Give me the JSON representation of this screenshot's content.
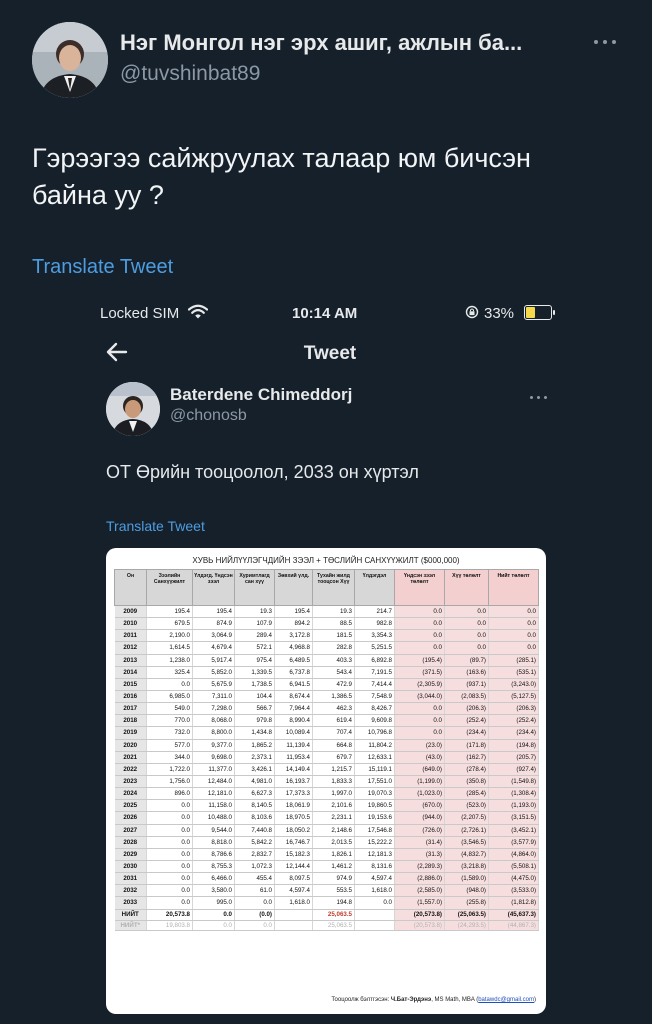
{
  "tweet": {
    "author_name": "Нэг Монгол нэг эрх ашиг, ажлын ба...",
    "author_handle": "@tuvshinbat89",
    "text_line1": "Гэрээгээ сайжруулах талаар юм бичсэн",
    "text_line2": "байна уу ?",
    "translate": "Translate Tweet"
  },
  "embedded": {
    "status_bar": {
      "carrier": "Locked SIM",
      "time": "10:14 AM",
      "battery": "33%"
    },
    "nav_title": "Tweet",
    "author_name": "Baterdene Chimeddorj",
    "author_handle": "@chonosb",
    "text": "ОТ Өрийн тооцоолол, 2033 он хүртэл",
    "translate": "Translate Tweet",
    "table": {
      "title": "ХУВЬ НИЙЛҮҮЛЭГЧДИЙН ЗЭЭЛ + ТӨСЛИЙН САНХҮҮЖИЛТ ($000,000)",
      "headers": [
        "Он",
        "Зээлийн Санхүүжилт",
        "Үлдэгд. Үндсэн зээл",
        "Хуримтлагд сан хүү",
        "Зөвхий үлд.",
        "Тухайн жилд тооцсон Хүү",
        "Үлдэгдэл",
        "Үндсэн зээл төлөлт",
        "Хүү төлөлт",
        "Нийт төлөлт"
      ],
      "rows": [
        [
          "2009",
          "195.4",
          "195.4",
          "19.3",
          "195.4",
          "19.3",
          "214.7",
          "0.0",
          "0.0",
          "0.0"
        ],
        [
          "2010",
          "679.5",
          "874.9",
          "107.9",
          "894.2",
          "88.5",
          "982.8",
          "0.0",
          "0.0",
          "0.0"
        ],
        [
          "2011",
          "2,190.0",
          "3,064.9",
          "289.4",
          "3,172.8",
          "181.5",
          "3,354.3",
          "0.0",
          "0.0",
          "0.0"
        ],
        [
          "2012",
          "1,614.5",
          "4,679.4",
          "572.1",
          "4,968.8",
          "282.8",
          "5,251.5",
          "0.0",
          "0.0",
          "0.0"
        ],
        [
          "2013",
          "1,238.0",
          "5,917.4",
          "975.4",
          "6,489.5",
          "403.3",
          "6,892.8",
          "(195.4)",
          "(89.7)",
          "(285.1)"
        ],
        [
          "2014",
          "325.4",
          "5,852.0",
          "1,339.5",
          "6,737.8",
          "543.4",
          "7,191.5",
          "(371.5)",
          "(163.6)",
          "(535.1)"
        ],
        [
          "2015",
          "0.0",
          "5,675.9",
          "1,738.5",
          "6,941.5",
          "472.9",
          "7,414.4",
          "(2,305.9)",
          "(937.1)",
          "(3,243.0)"
        ],
        [
          "2016",
          "6,985.0",
          "7,311.0",
          "104.4",
          "8,674.4",
          "1,386.5",
          "7,548.9",
          "(3,044.0)",
          "(2,083.5)",
          "(5,127.5)"
        ],
        [
          "2017",
          "549.0",
          "7,298.0",
          "566.7",
          "7,964.4",
          "462.3",
          "8,426.7",
          "0.0",
          "(206.3)",
          "(206.3)"
        ],
        [
          "2018",
          "770.0",
          "8,068.0",
          "979.8",
          "8,990.4",
          "619.4",
          "9,609.8",
          "0.0",
          "(252.4)",
          "(252.4)"
        ],
        [
          "2019",
          "732.0",
          "8,800.0",
          "1,434.8",
          "10,089.4",
          "707.4",
          "10,796.8",
          "0.0",
          "(234.4)",
          "(234.4)"
        ],
        [
          "2020",
          "577.0",
          "9,377.0",
          "1,865.2",
          "11,139.4",
          "664.8",
          "11,804.2",
          "(23.0)",
          "(171.8)",
          "(194.8)"
        ],
        [
          "2021",
          "344.0",
          "9,698.0",
          "2,373.1",
          "11,953.4",
          "679.7",
          "12,633.1",
          "(43.0)",
          "(162.7)",
          "(205.7)"
        ],
        [
          "2022",
          "1,722.0",
          "11,377.0",
          "3,426.1",
          "14,149.4",
          "1,215.7",
          "15,119.1",
          "(649.0)",
          "(278.4)",
          "(927.4)"
        ],
        [
          "2023",
          "1,756.0",
          "12,484.0",
          "4,981.0",
          "16,193.7",
          "1,833.3",
          "17,551.0",
          "(1,199.0)",
          "(350.8)",
          "(1,549.8)"
        ],
        [
          "2024",
          "896.0",
          "12,181.0",
          "6,627.3",
          "17,373.3",
          "1,997.0",
          "19,070.3",
          "(1,023.0)",
          "(285.4)",
          "(1,308.4)"
        ],
        [
          "2025",
          "0.0",
          "11,158.0",
          "8,140.5",
          "18,061.9",
          "2,101.6",
          "19,860.5",
          "(670.0)",
          "(523.0)",
          "(1,193.0)"
        ],
        [
          "2026",
          "0.0",
          "10,488.0",
          "8,103.6",
          "18,970.5",
          "2,231.1",
          "19,153.6",
          "(944.0)",
          "(2,207.5)",
          "(3,151.5)"
        ],
        [
          "2027",
          "0.0",
          "9,544.0",
          "7,440.8",
          "18,050.2",
          "2,148.6",
          "17,546.8",
          "(726.0)",
          "(2,726.1)",
          "(3,452.1)"
        ],
        [
          "2028",
          "0.0",
          "8,818.0",
          "5,842.2",
          "16,746.7",
          "2,013.5",
          "15,222.2",
          "(31.4)",
          "(3,546.5)",
          "(3,577.9)"
        ],
        [
          "2029",
          "0.0",
          "8,786.6",
          "2,832.7",
          "15,182.3",
          "1,826.1",
          "12,181.3",
          "(31.3)",
          "(4,832.7)",
          "(4,864.0)"
        ],
        [
          "2030",
          "0.0",
          "8,755.3",
          "1,072.3",
          "12,144.4",
          "1,461.2",
          "8,131.6",
          "(2,289.3)",
          "(3,218.8)",
          "(5,508.1)"
        ],
        [
          "2031",
          "0.0",
          "6,466.0",
          "455.4",
          "8,097.5",
          "974.9",
          "4,597.4",
          "(2,886.0)",
          "(1,589.0)",
          "(4,475.0)"
        ],
        [
          "2032",
          "0.0",
          "3,580.0",
          "61.0",
          "4,597.4",
          "553.5",
          "1,618.0",
          "(2,585.0)",
          "(948.0)",
          "(3,533.0)"
        ],
        [
          "2033",
          "0.0",
          "995.0",
          "0.0",
          "1,618.0",
          "194.8",
          "0.0",
          "(1,557.0)",
          "(255.8)",
          "(1,812.8)"
        ]
      ],
      "total_row": [
        "НИЙТ",
        "20,573.8",
        "0.0",
        "(0.0)",
        "",
        "25,063.5",
        "",
        "(20,573.8)",
        "(25,063.5)",
        "(45,637.3)"
      ],
      "total_row2": [
        "НИЙТ*",
        "19,803.8",
        "0.0",
        "0.0",
        "",
        "25,063.5",
        "",
        "(20,573.8)",
        "(24,293.5)",
        "(44,867.3)"
      ],
      "footer_prefix": "Тооцоолж бэлтгэсэн:",
      "footer_author": "Ч.Бат-Эрдэнэ",
      "footer_degree": ", MS Math, MBA",
      "footer_email": "batawdc@gmail.com"
    }
  }
}
